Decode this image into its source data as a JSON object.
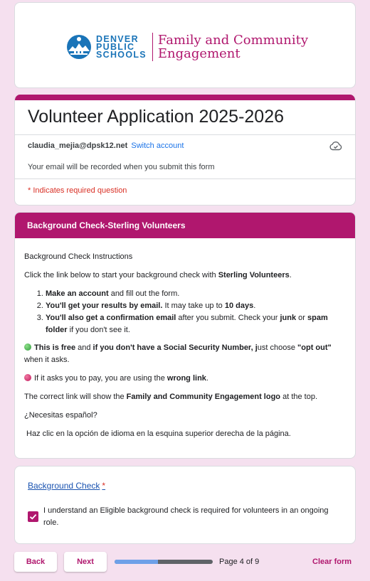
{
  "header": {
    "logo_lines": [
      "DENVER",
      "PUBLIC",
      "SCHOOLS"
    ],
    "department_line1": "Family and Community",
    "department_line2": "Engagement",
    "colors": {
      "brand_blue": "#1a74b8",
      "brand_magenta": "#b0176e"
    }
  },
  "form": {
    "title": "Volunteer Application 2025-2026",
    "account_email": "claudia_mejia@dpsk12.net",
    "switch_account": "Switch account",
    "email_notice": "Your email will be recorded when you submit this form",
    "required_note": "* Indicates required question",
    "cloud_icon": "cloud-saved-icon"
  },
  "section": {
    "title": "Background Check-Sterling Volunteers",
    "instructions_heading": "Background Check Instructions",
    "intro_prefix": "Click the link below to start your background check with ",
    "intro_bold": "Sterling Volunteers",
    "intro_suffix": ".",
    "steps": [
      {
        "bold": "Make an account",
        "rest": " and fill out the form."
      },
      {
        "bold": "You'll get your results by email.",
        "rest": " It may take up to ",
        "bold2": "10 days",
        "rest2": "."
      },
      {
        "bold": "You'll also get a confirmation email",
        "rest": " after you submit. Check your ",
        "bold2": "junk",
        "rest2": " or ",
        "bold3": "spam folder",
        "rest3": " if you don't see it."
      }
    ],
    "free_bold1": "This is free",
    "free_text1": " and ",
    "free_bold2": "if you don't have a Social Security Number, j",
    "free_text2": "ust choose ",
    "free_bold3": "\"opt out\"",
    "free_text3": " when it asks.",
    "pay_text": "If it asks you to pay, you are using the ",
    "pay_bold": "wrong link",
    "pay_suffix": ".",
    "correct_prefix": "The correct link will show the ",
    "correct_bold": "Family and Community Engagement logo",
    "correct_suffix": " at the top.",
    "spanish_question": "¿Necesitas español?",
    "spanish_instruction": " Haz clic en la opción de idioma en la esquina superior derecha de la página."
  },
  "question": {
    "link_text": "Background Check",
    "required_star": "*",
    "checkbox_checked": true,
    "checkbox_label": "I understand an Eligible background check is required for volunteers in an ongoing role."
  },
  "footer": {
    "back_label": "Back",
    "next_label": "Next",
    "progress_fraction": 0.44,
    "page_indicator": "Page 4 of 9",
    "clear_form": "Clear form"
  }
}
